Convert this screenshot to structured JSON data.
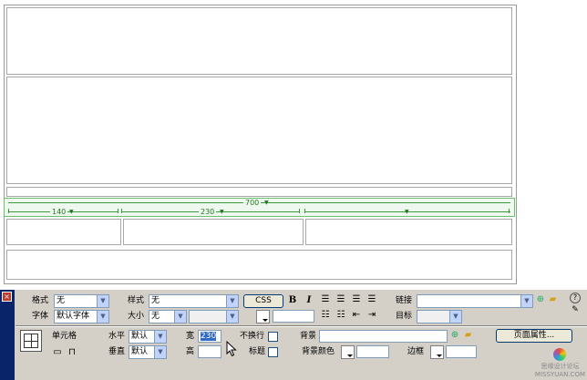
{
  "ruler": {
    "total": "700",
    "col1": "140",
    "col2": "230"
  },
  "inspector": {
    "close_glyph": "×",
    "format_label": "格式",
    "format_value": "无",
    "font_label": "字体",
    "font_value": "默认字体",
    "style_label": "样式",
    "style_value": "无",
    "size_label": "大小",
    "size_value": "无",
    "css_button": "CSS",
    "bold": "B",
    "italic": "I",
    "link_label": "链接",
    "target_label": "目标",
    "cell_label": "单元格",
    "horz_label": "水平",
    "horz_value": "默认",
    "vert_label": "垂直",
    "vert_value": "默认",
    "width_label": "宽",
    "width_value": "230",
    "height_label": "高",
    "nowrap_label": "不换行",
    "header_label": "标题",
    "bg_label": "背景",
    "bgcolor_label": "背景颜色",
    "border_label": "边框",
    "page_props_button": "页面属性...",
    "help_glyph": "?"
  },
  "watermark": {
    "line1": "思缘设计论坛",
    "line2": "MISSYUAN.COM"
  },
  "colors": {
    "ruler": "#3b9a3b",
    "inspector_bg": "#d4d0c8",
    "inspector_edge": "#0a246a",
    "selection": "#316ac5"
  }
}
